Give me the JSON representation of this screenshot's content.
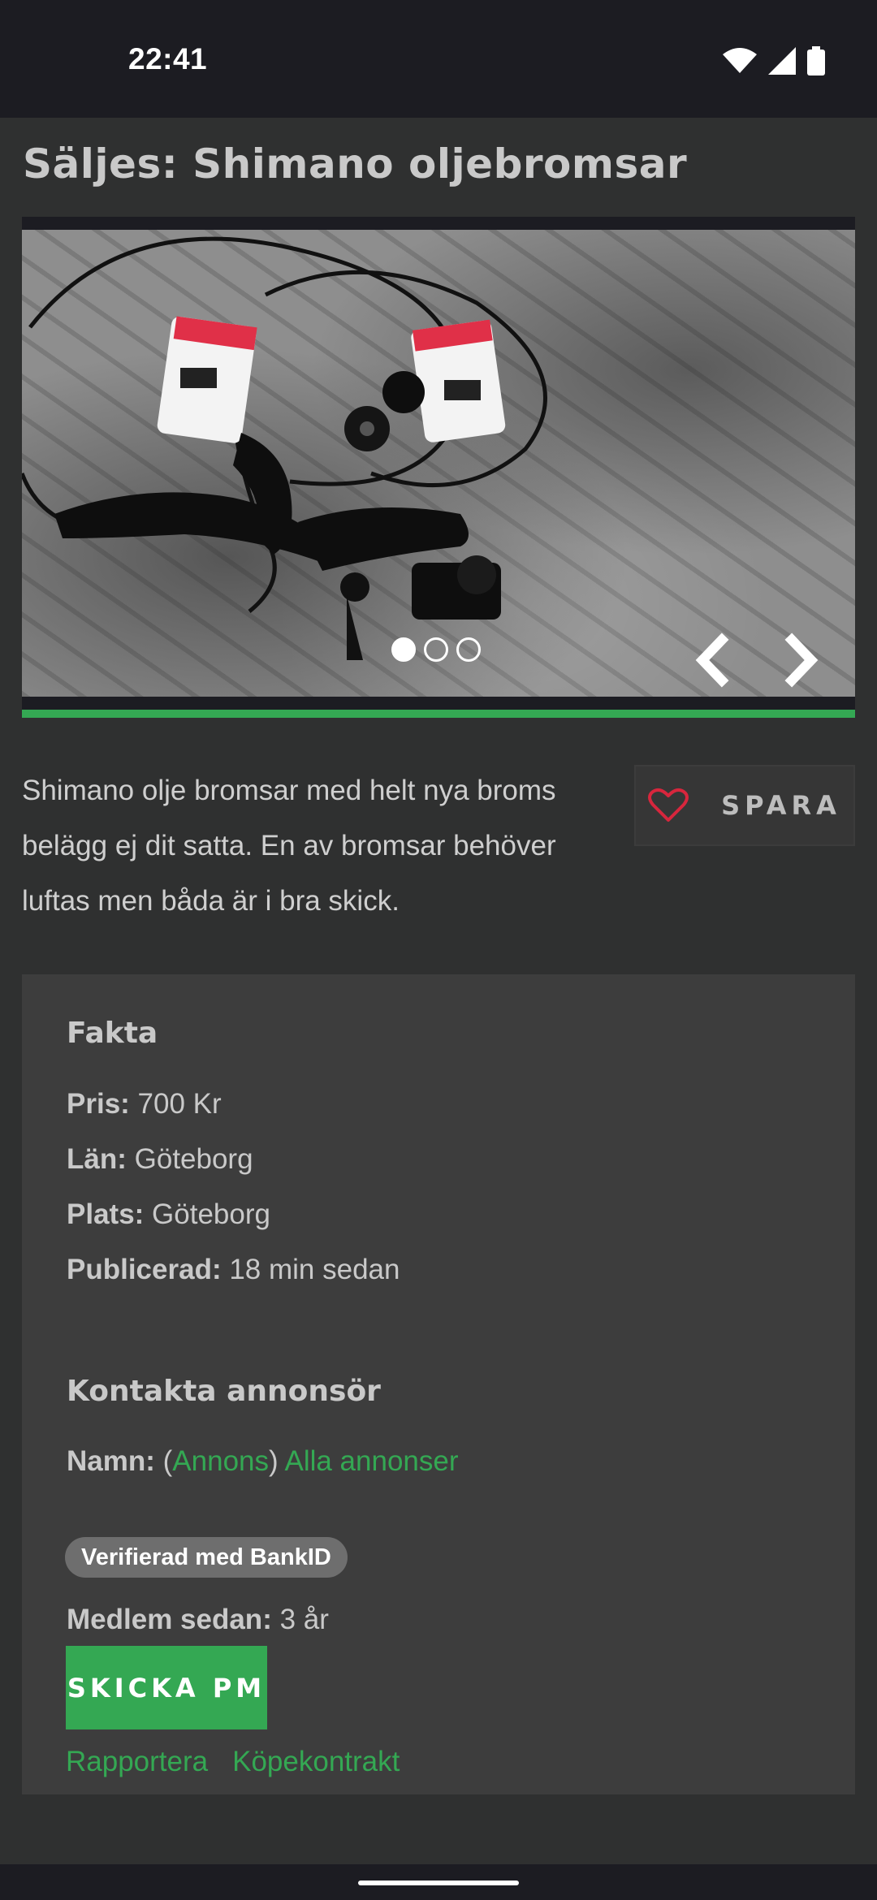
{
  "status": {
    "time": "22:41"
  },
  "listing": {
    "title": "Säljes: Shimano oljebromsar",
    "description": "Shimano olje bromsar med helt nya broms belägg ej dit satta. En av bromsar behöver luftas men båda är i bra skick.",
    "save_label": "SPARA",
    "gallery": {
      "image_count": 3,
      "active_index": 1
    }
  },
  "facts": {
    "heading": "Fakta",
    "price_label": "Pris:",
    "price_value": "700 Kr",
    "county_label": "Län:",
    "county_value": "Göteborg",
    "place_label": "Plats:",
    "place_value": "Göteborg",
    "published_label": "Publicerad:",
    "published_value": "18 min sedan"
  },
  "contact": {
    "heading": "Kontakta annonsör",
    "name_label": "Namn:",
    "name_open_paren": "(",
    "name_link": "Annons",
    "name_close_paren": ")",
    "all_ads_link": "Alla annonser",
    "verified_badge": "Verifierad med BankID",
    "member_label": "Medlem sedan:",
    "member_value": "3 år",
    "pm_button": "SKICKA PM",
    "report_link": "Rapportera",
    "contract_link": "Köpekontrakt"
  },
  "colors": {
    "background": "#2f3030",
    "card": "#3d3d3d",
    "accent_green": "#34a853",
    "heart_red": "#d7263d"
  }
}
